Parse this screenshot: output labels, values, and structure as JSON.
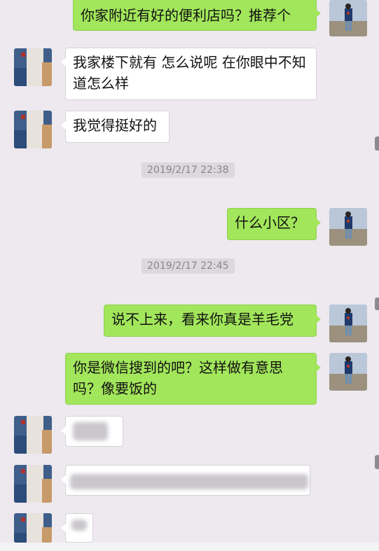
{
  "colors": {
    "background": "#ede9ef",
    "sent_bubble": "#a2e65b",
    "received_bubble": "#ffffff",
    "timestamp_bg": "#dcd8de"
  },
  "messages": [
    {
      "side": "right",
      "text": "你家附近有好的便利店吗？推荐个",
      "avatar": "self-avatar"
    },
    {
      "side": "left",
      "text": "我家楼下就有 怎么说呢 在你眼中不知道怎么样",
      "avatar": "friend-avatar"
    },
    {
      "side": "left",
      "text": "我觉得挺好的",
      "avatar": "friend-avatar"
    },
    {
      "type": "timestamp",
      "text": "2019/2/17 22:38"
    },
    {
      "side": "right",
      "text": "什么小区？",
      "avatar": "self-avatar"
    },
    {
      "type": "timestamp",
      "text": "2019/2/17 22:45"
    },
    {
      "side": "right",
      "text": "说不上来，看来你真是羊毛党",
      "avatar": "self-avatar"
    },
    {
      "side": "right",
      "text": "你是微信搜到的吧？这样做有意思吗？像要饭的",
      "avatar": "self-avatar"
    },
    {
      "side": "left",
      "text": "",
      "avatar": "friend-avatar",
      "redacted": true
    },
    {
      "side": "left",
      "text": "",
      "avatar": "friend-avatar",
      "redacted": true
    },
    {
      "side": "left",
      "text": "",
      "avatar": "friend-avatar",
      "redacted": true
    }
  ]
}
